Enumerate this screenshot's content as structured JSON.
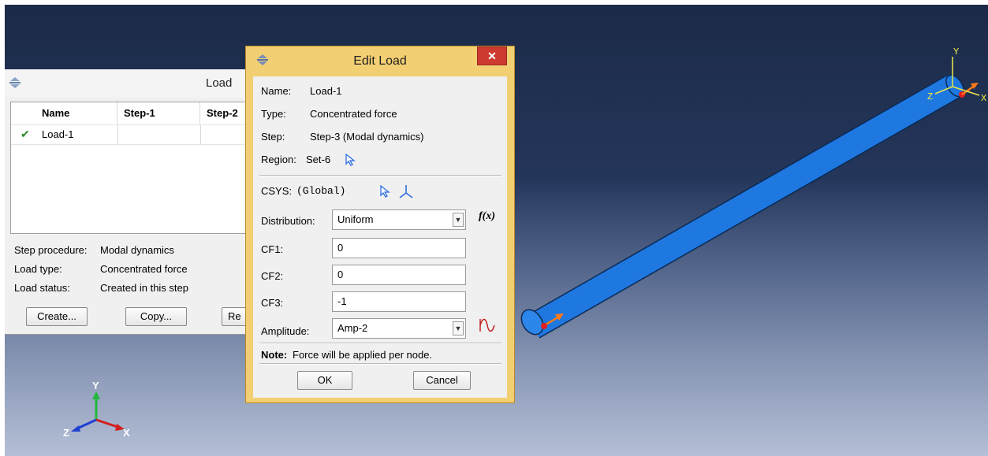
{
  "load_manager": {
    "title": "Load",
    "columns": [
      "Name",
      "Step-1",
      "Step-2"
    ],
    "rows": [
      {
        "check": "✔",
        "name": "Load-1"
      }
    ],
    "info": {
      "step_procedure_label": "Step procedure:",
      "step_procedure_value": "Modal dynamics",
      "load_type_label": "Load type:",
      "load_type_value": "Concentrated force",
      "load_status_label": "Load status:",
      "load_status_value": "Created in this step"
    },
    "buttons": {
      "create": "Create...",
      "copy": "Copy...",
      "rename_partial": "Re"
    }
  },
  "edit_load": {
    "title": "Edit Load",
    "close": "✕",
    "name_label": "Name:",
    "name_value": "Load-1",
    "type_label": "Type:",
    "type_value": "Concentrated force",
    "step_label": "Step:",
    "step_value": "Step-3 (Modal dynamics)",
    "region_label": "Region:",
    "region_value": "Set-6",
    "csys_label": "CSYS:",
    "csys_value": "(Global)",
    "distribution_label": "Distribution:",
    "distribution_value": "Uniform",
    "fx_label": "f(x)",
    "cf1_label": "CF1:",
    "cf1_value": "0",
    "cf2_label": "CF2:",
    "cf2_value": "0",
    "cf3_label": "CF3:",
    "cf3_value": "-1",
    "amplitude_label": "Amplitude:",
    "amplitude_value": "Amp-2",
    "note_label": "Note:",
    "note_text": "Force will be applied per node.",
    "ok": "OK",
    "cancel": "Cancel"
  },
  "viewport": {
    "triad": {
      "x": "X",
      "y": "Y",
      "z": "Z"
    },
    "part_triad": {
      "x": "X",
      "y": "Y",
      "z": "Z"
    }
  },
  "colors": {
    "dialog_frame": "#f3cf73",
    "close_button": "#cc3a2f",
    "tube": "#1f77e0",
    "check": "#2a8a2a"
  },
  "icons": [
    "window-menu-icon",
    "select-arrow-icon",
    "csys-triad-icon",
    "amplitude-wave-icon",
    "checkmark-icon",
    "dropdown-arrow-icon"
  ]
}
